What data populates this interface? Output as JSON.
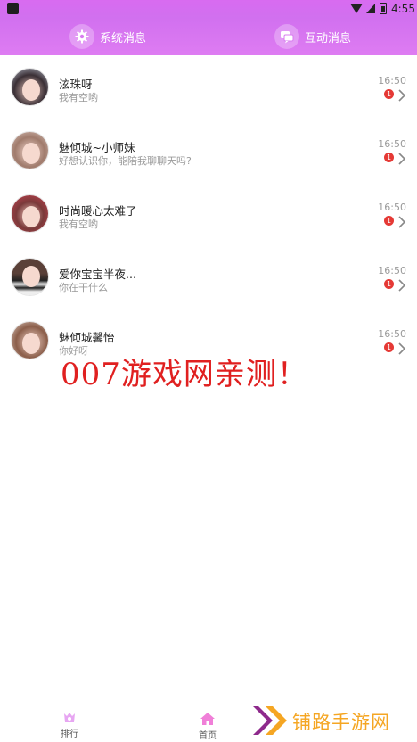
{
  "status_bar": {
    "time": "4:55"
  },
  "header": {
    "tabs": [
      {
        "label": "系统消息",
        "icon": "gear-icon"
      },
      {
        "label": "互动消息",
        "icon": "chat-bubbles-icon"
      }
    ]
  },
  "messages": [
    {
      "name": "泫珠呀",
      "preview": "我有空哟",
      "time": "16:50",
      "unread": "1"
    },
    {
      "name": "魅倾城~小师妹",
      "preview": "好想认识你，能陪我聊聊天吗?",
      "time": "16:50",
      "unread": "1"
    },
    {
      "name": "时尚暖心太难了",
      "preview": "我有空哟",
      "time": "16:50",
      "unread": "1"
    },
    {
      "name": "爱你宝宝半夜...",
      "preview": "你在干什么",
      "time": "16:50",
      "unread": "1"
    },
    {
      "name": "魅倾城馨怡",
      "preview": "你好呀",
      "time": "16:50",
      "unread": "1"
    }
  ],
  "watermark": "007游戏网亲测！",
  "bottom_nav": {
    "items": [
      {
        "label": "排行",
        "icon": "trophy-icon"
      },
      {
        "label": "首页",
        "icon": "home-icon"
      }
    ]
  },
  "brand_logo": {
    "text": "铺路手游网"
  },
  "colors": {
    "header_gradient_start": "#d170ef",
    "header_gradient_end": "#de7cf2",
    "badge": "#e53935",
    "watermark": "#e02020",
    "brand_orange": "#f5a623",
    "brand_purple": "#8e2a8c"
  }
}
